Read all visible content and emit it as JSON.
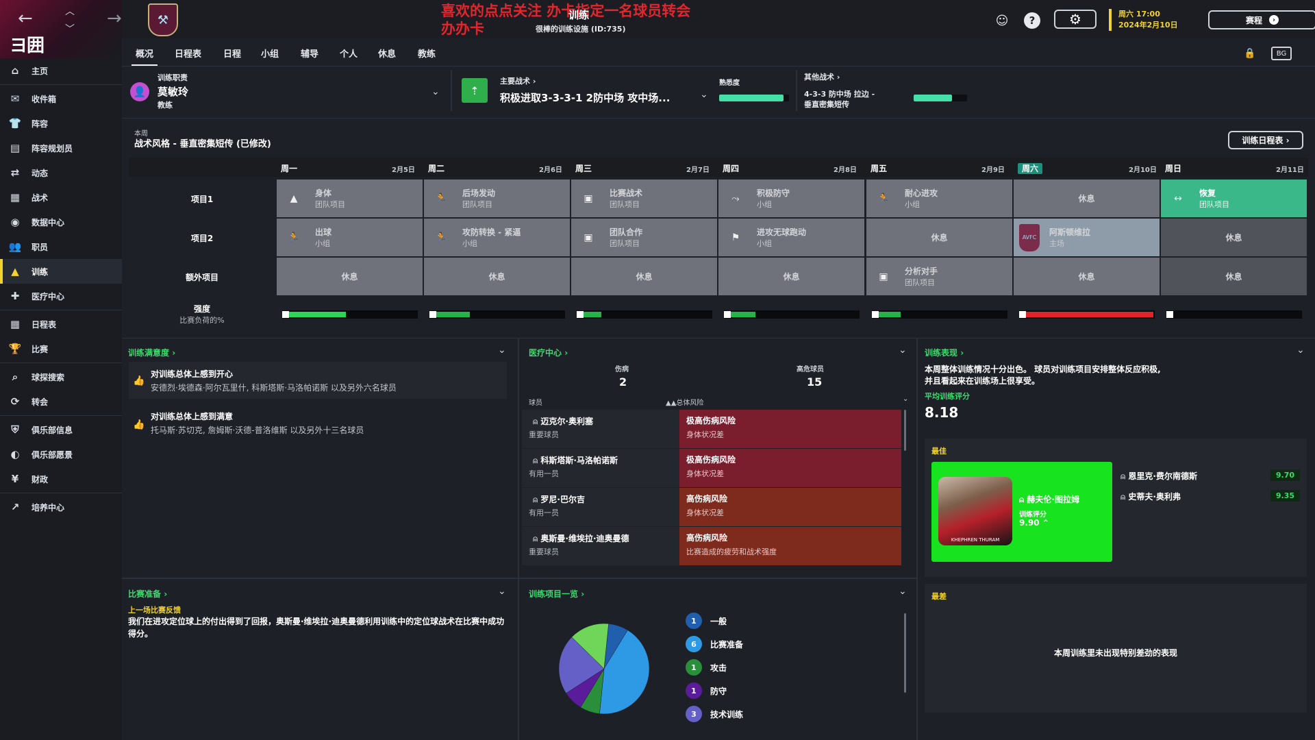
{
  "sidebar": {
    "logo": "ヨ囲",
    "items": [
      {
        "label": "主页",
        "icon": "home-icon",
        "glyph": "⌂"
      },
      {
        "label": "收件箱",
        "icon": "inbox-icon",
        "glyph": "✉"
      },
      {
        "label": "阵容",
        "icon": "shirt-icon",
        "glyph": "👕"
      },
      {
        "label": "阵容规划员",
        "icon": "clipboard-icon",
        "glyph": "▤"
      },
      {
        "label": "动态",
        "icon": "dynamics-icon",
        "glyph": "⇄"
      },
      {
        "label": "战术",
        "icon": "tactics-icon",
        "glyph": "▦"
      },
      {
        "label": "数据中心",
        "icon": "data-hub-icon",
        "glyph": "◉"
      },
      {
        "label": "职员",
        "icon": "staff-icon",
        "glyph": "👥"
      },
      {
        "label": "训练",
        "icon": "training-icon",
        "glyph": "▲"
      },
      {
        "label": "医疗中心",
        "icon": "medical-icon",
        "glyph": "✚"
      },
      {
        "label": "日程表",
        "icon": "calendar-icon",
        "glyph": "▦"
      },
      {
        "label": "比赛",
        "icon": "trophy-icon",
        "glyph": "🏆"
      },
      {
        "label": "球探搜索",
        "icon": "search-icon",
        "glyph": "⌕"
      },
      {
        "label": "转会",
        "icon": "transfer-icon",
        "glyph": "⟳"
      },
      {
        "label": "俱乐部信息",
        "icon": "shield-icon",
        "glyph": "⛨"
      },
      {
        "label": "俱乐部愿景",
        "icon": "vision-icon",
        "glyph": "◐"
      },
      {
        "label": "财政",
        "icon": "finance-icon",
        "glyph": "¥"
      },
      {
        "label": "培养中心",
        "icon": "development-icon",
        "glyph": "↗"
      }
    ]
  },
  "header": {
    "overlay_line1": "喜欢的点点关注  办卡指定一名球员转会",
    "overlay_line2": "办办卡",
    "title": "训练",
    "subtitle": "很棒的训练设施 (ID:735)",
    "date_line1": "周六 17:00",
    "date_line2": "2024年2月10日",
    "continue_label": "赛程",
    "help": "?"
  },
  "tabs": [
    "概况",
    "日程表",
    "日程",
    "小组",
    "辅导",
    "个人",
    "休息",
    "教练"
  ],
  "staff": {
    "label": "训练职责",
    "name": "莫敏玲",
    "role": "教练"
  },
  "tactic": {
    "main_label": "主要战术",
    "main_name": "积极进取3-3-3-1 2防中场 攻中场...",
    "familiarity_label": "熟悉度",
    "familiarity": 0.92,
    "other_label": "其他战术",
    "other_name_1": "4-3-3 防中场 拉边 -",
    "other_name_2": "垂直密集短传",
    "other_familiarity": 0.72
  },
  "week": {
    "label": "本周",
    "style": "战术风格 - 垂直密集短传 (已修改)",
    "schedule_button": "训练日程表",
    "days": [
      {
        "name": "周一",
        "date": "2月5日",
        "highlight": false
      },
      {
        "name": "周二",
        "date": "2月6日",
        "highlight": false
      },
      {
        "name": "周三",
        "date": "2月7日",
        "highlight": false
      },
      {
        "name": "周四",
        "date": "2月8日",
        "highlight": false
      },
      {
        "name": "周五",
        "date": "2月9日",
        "highlight": false
      },
      {
        "name": "周六",
        "date": "2月10日",
        "highlight": true
      },
      {
        "name": "周日",
        "date": "2月11日",
        "highlight": false
      }
    ],
    "row_labels": [
      "项目1",
      "项目2",
      "额外项目"
    ],
    "intensity_label": "强度",
    "intensity_sub": "比赛负荷的%",
    "sessions": [
      [
        {
          "t1": "身体",
          "t2": "团队项目",
          "icon": "▲",
          "style": ""
        },
        {
          "t1": "后场发动",
          "t2": "团队项目",
          "icon": "🏃",
          "style": ""
        },
        {
          "t1": "比赛战术",
          "t2": "团队项目",
          "icon": "▣",
          "style": ""
        },
        {
          "t1": "积极防守",
          "t2": "小组",
          "icon": "⤳",
          "style": ""
        },
        {
          "t1": "耐心进攻",
          "t2": "小组",
          "icon": "🏃",
          "style": ""
        },
        {
          "t1": "休息",
          "t2": "",
          "icon": "",
          "style": "rest"
        },
        {
          "t1": "恢复",
          "t2": "团队项目",
          "icon": "↔",
          "style": "green"
        }
      ],
      [
        {
          "t1": "出球",
          "t2": "小组",
          "icon": "🏃",
          "style": ""
        },
        {
          "t1": "攻防转换 - 紧逼",
          "t2": "小组",
          "icon": "🏃",
          "style": ""
        },
        {
          "t1": "团队合作",
          "t2": "团队项目",
          "icon": "▣",
          "style": ""
        },
        {
          "t1": "进攻无球跑动",
          "t2": "小组",
          "icon": "⚑",
          "style": ""
        },
        {
          "t1": "休息",
          "t2": "",
          "icon": "",
          "style": "rest"
        },
        {
          "t1": "阿斯顿维拉",
          "t2": "主场",
          "icon": "AVFC",
          "style": "lightblue"
        },
        {
          "t1": "休息",
          "t2": "",
          "icon": "",
          "style": "rest dark"
        }
      ],
      [
        {
          "t1": "休息",
          "t2": "",
          "icon": "",
          "style": "rest"
        },
        {
          "t1": "休息",
          "t2": "",
          "icon": "",
          "style": "rest"
        },
        {
          "t1": "休息",
          "t2": "",
          "icon": "",
          "style": "rest"
        },
        {
          "t1": "休息",
          "t2": "",
          "icon": "",
          "style": "rest"
        },
        {
          "t1": "分析对手",
          "t2": "团队项目",
          "icon": "▣",
          "style": ""
        },
        {
          "t1": "休息",
          "t2": "",
          "icon": "",
          "style": "rest"
        },
        {
          "t1": "休息",
          "t2": "",
          "icon": "",
          "style": "rest dark"
        }
      ]
    ],
    "intensity": [
      {
        "value": 0.45,
        "color": "#2bd657"
      },
      {
        "value": 0.27,
        "color": "#23b44a"
      },
      {
        "value": 0.15,
        "color": "#23b44a"
      },
      {
        "value": 0.2,
        "color": "#23b44a"
      },
      {
        "value": 0.18,
        "color": "#23b44a"
      },
      {
        "value": 1.0,
        "color": "#e3232b"
      },
      {
        "value": 0.0,
        "color": "#23b44a"
      }
    ]
  },
  "satisfaction": {
    "title": "训练满意度",
    "items": [
      {
        "head": "对训练总体上感到开心",
        "body": "安德烈·埃德森·阿尔瓦里什, 科斯塔斯·马洛帕诺斯 以及另外六名球员"
      },
      {
        "head": "对训练总体上感到满意",
        "body": "托马斯·苏切克, 詹姆斯·沃德-普洛维斯 以及另外十三名球员"
      }
    ]
  },
  "medical": {
    "title": "医疗中心",
    "injured_label": "伤病",
    "injured_count": "2",
    "high_risk_label": "高危球员",
    "high_risk_count": "15",
    "col_player": "球员",
    "col_risk": "▲▲总体风险",
    "rows": [
      {
        "name": "迈克尔·奥利塞",
        "role": "重要球员",
        "risk": "极高伤病风险",
        "reason": "身体状况差",
        "color": "#7a1d2c"
      },
      {
        "name": "科斯塔斯·马洛帕诺斯",
        "role": "有用一员",
        "risk": "极高伤病风险",
        "reason": "身体状况差",
        "color": "#7a1d2c"
      },
      {
        "name": "罗尼·巴尔吉",
        "role": "有用一员",
        "risk": "高伤病风险",
        "reason": "身体状况差",
        "color": "#7e2a1c"
      },
      {
        "name": "奥斯曼·维埃拉·迪奥曼德",
        "role": "重要球员",
        "risk": "高伤病风险",
        "reason": "比赛造成的疲劳和战术强度",
        "color": "#7e2a1c"
      }
    ]
  },
  "performance": {
    "title": "训练表现",
    "summary_1": "本周整体训练情况十分出色。 球员对训练项目安排整体反应积极,",
    "summary_2": "并且看起来在训练场上很享受。",
    "avg_label": "平均训练评分",
    "avg_value": "8.18",
    "best_label": "最佳",
    "best_player": "赫夫伦·图拉姆",
    "best_rating_label": "训练评分",
    "best_rating": "9.90",
    "photo_caption": "KHEPHREN THURAM",
    "others": [
      {
        "name": "恩里克·费尔南德斯",
        "rating": "9.70"
      },
      {
        "name": "史蒂夫·奥利弗",
        "rating": "9.35"
      }
    ],
    "worst_label": "最差",
    "worst_text": "本周训练里未出现特别差劲的表现"
  },
  "match_prep": {
    "title": "比赛准备",
    "sub": "上一场比赛反馈",
    "text": "我们在进攻定位球上的付出得到了回报，奥斯曼·维埃拉·迪奥曼德利用训练中的定位球战术在比赛中成功得分。"
  },
  "overview": {
    "title": "训练项目一览",
    "legend": [
      {
        "count": "1",
        "label": "一般",
        "color": "#1f5fae"
      },
      {
        "count": "6",
        "label": "比赛准备",
        "color": "#2e9ae6"
      },
      {
        "count": "1",
        "label": "攻击",
        "color": "#2a8f3a"
      },
      {
        "count": "1",
        "label": "防守",
        "color": "#5a1c9a"
      },
      {
        "count": "3",
        "label": "技术训练",
        "color": "#6560c8"
      }
    ]
  },
  "chart_data": {
    "type": "pie",
    "categories": [
      "一般",
      "比赛准备",
      "攻击",
      "防守",
      "技术训练",
      "other"
    ],
    "values": [
      1,
      6,
      1,
      1,
      3,
      2
    ],
    "colors": [
      "#1f5fae",
      "#2e9ae6",
      "#2a8f3a",
      "#5a1c9a",
      "#6560c8",
      "#6fd65a"
    ]
  }
}
